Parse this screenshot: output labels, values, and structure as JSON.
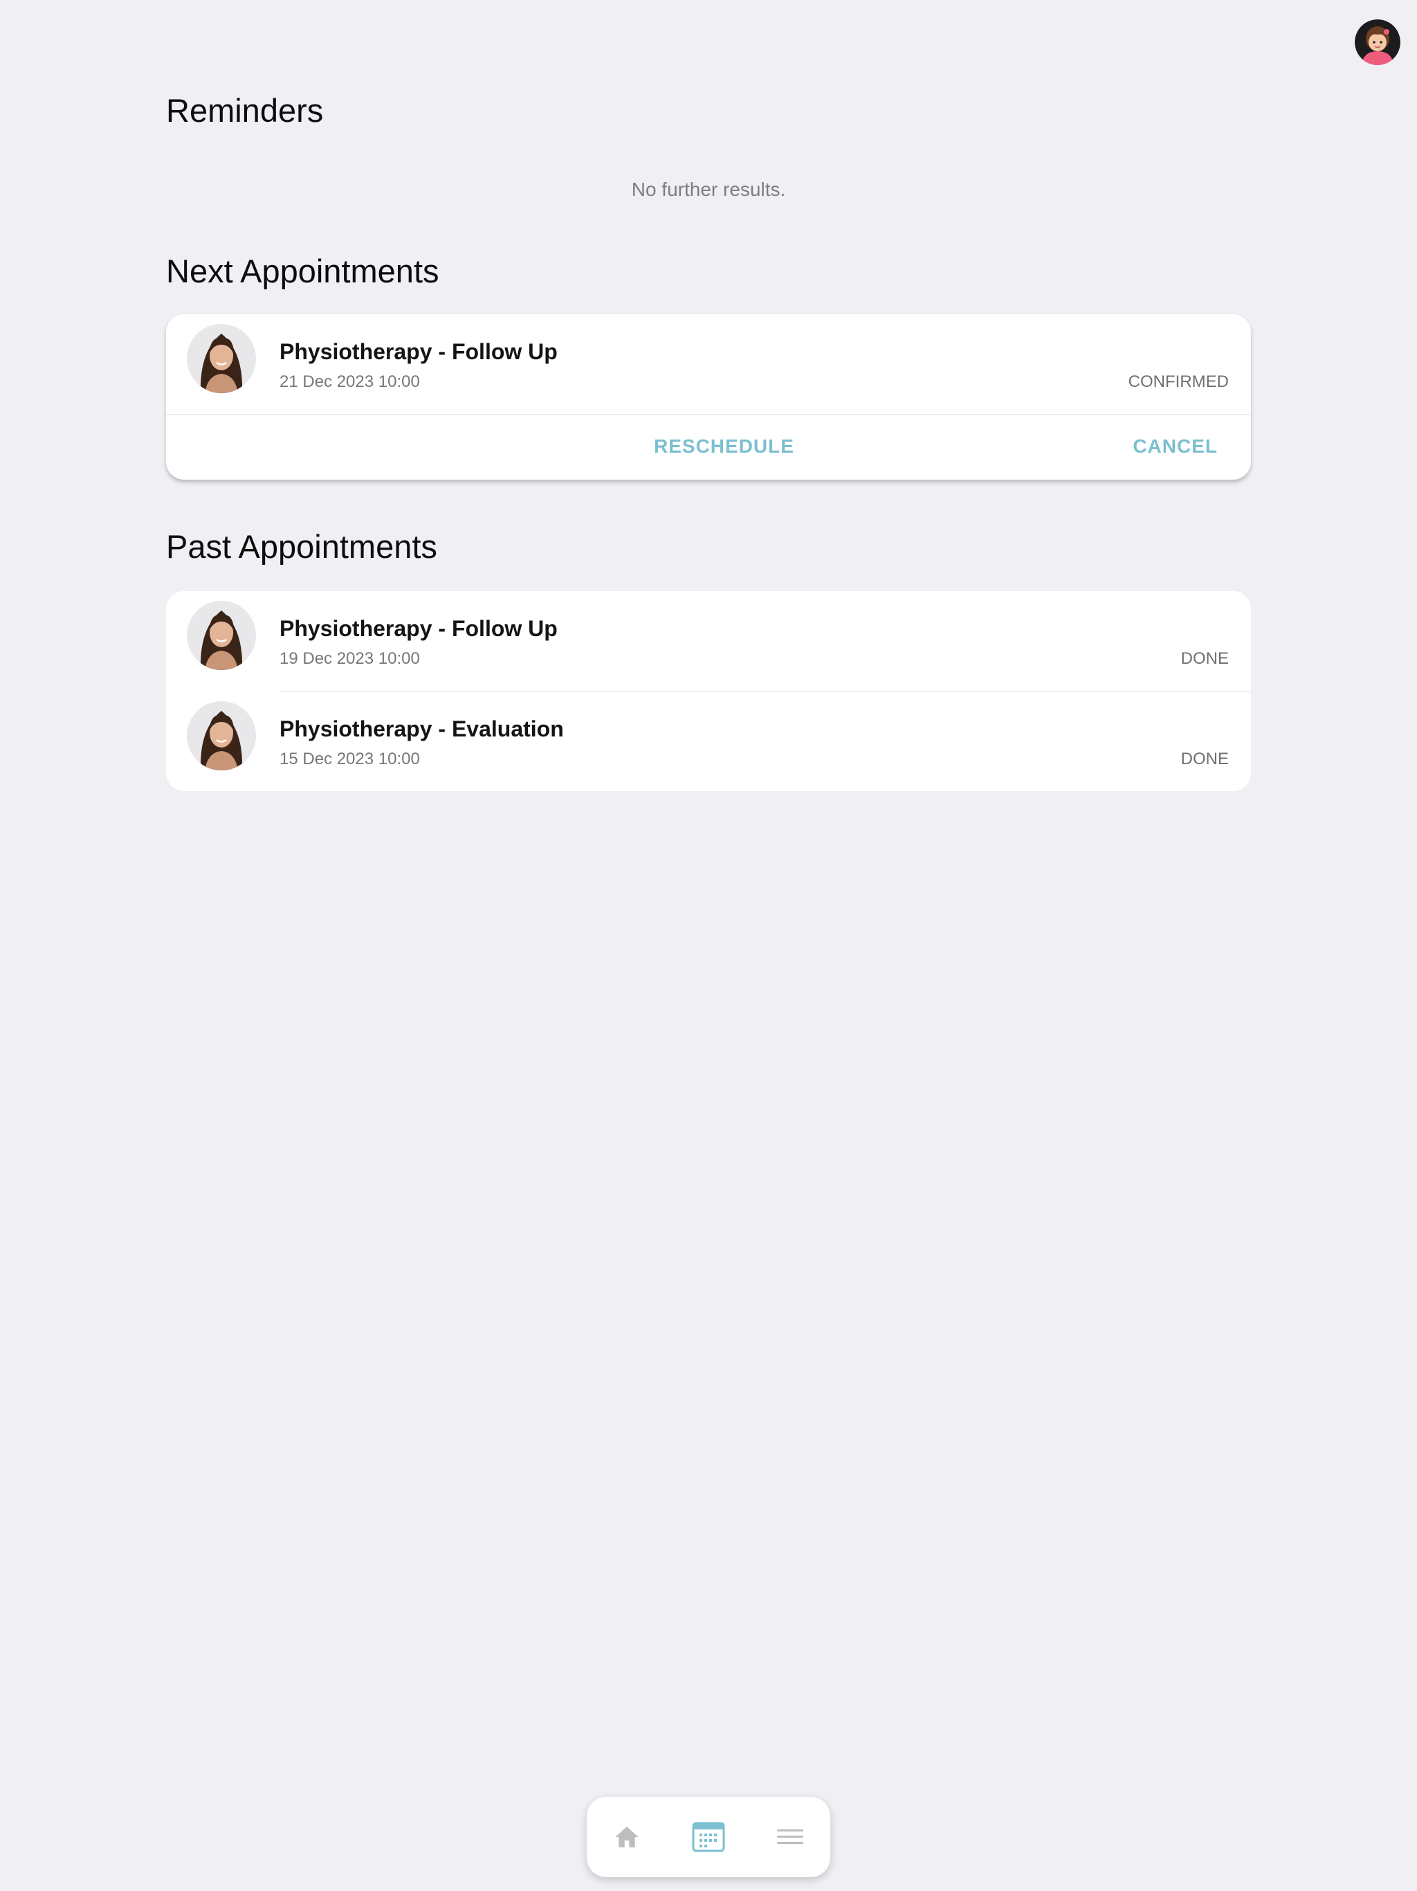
{
  "header": {
    "avatar_icon": "user-avatar-girl-icon"
  },
  "reminders": {
    "title": "Reminders",
    "empty_text": "No further results."
  },
  "next_appointments": {
    "title": "Next Appointments",
    "items": [
      {
        "title": "Physiotherapy - Follow Up",
        "datetime": "21 Dec 2023 10:00",
        "status": "CONFIRMED",
        "reschedule_label": "RESCHEDULE",
        "cancel_label": "CANCEL"
      }
    ]
  },
  "past_appointments": {
    "title": "Past Appointments",
    "items": [
      {
        "title": "Physiotherapy - Follow Up",
        "datetime": "19 Dec 2023 10:00",
        "status": "DONE"
      },
      {
        "title": "Physiotherapy - Evaluation",
        "datetime": "15 Dec 2023 10:00",
        "status": "DONE"
      }
    ]
  },
  "bottom_nav": {
    "items": [
      {
        "icon": "home-icon",
        "active": false
      },
      {
        "icon": "calendar-icon",
        "active": true
      },
      {
        "icon": "menu-icon",
        "active": false
      }
    ]
  },
  "colors": {
    "background": "#efeff4",
    "accent": "#7bbfd0",
    "inactive_icon": "#bdbdbd"
  }
}
